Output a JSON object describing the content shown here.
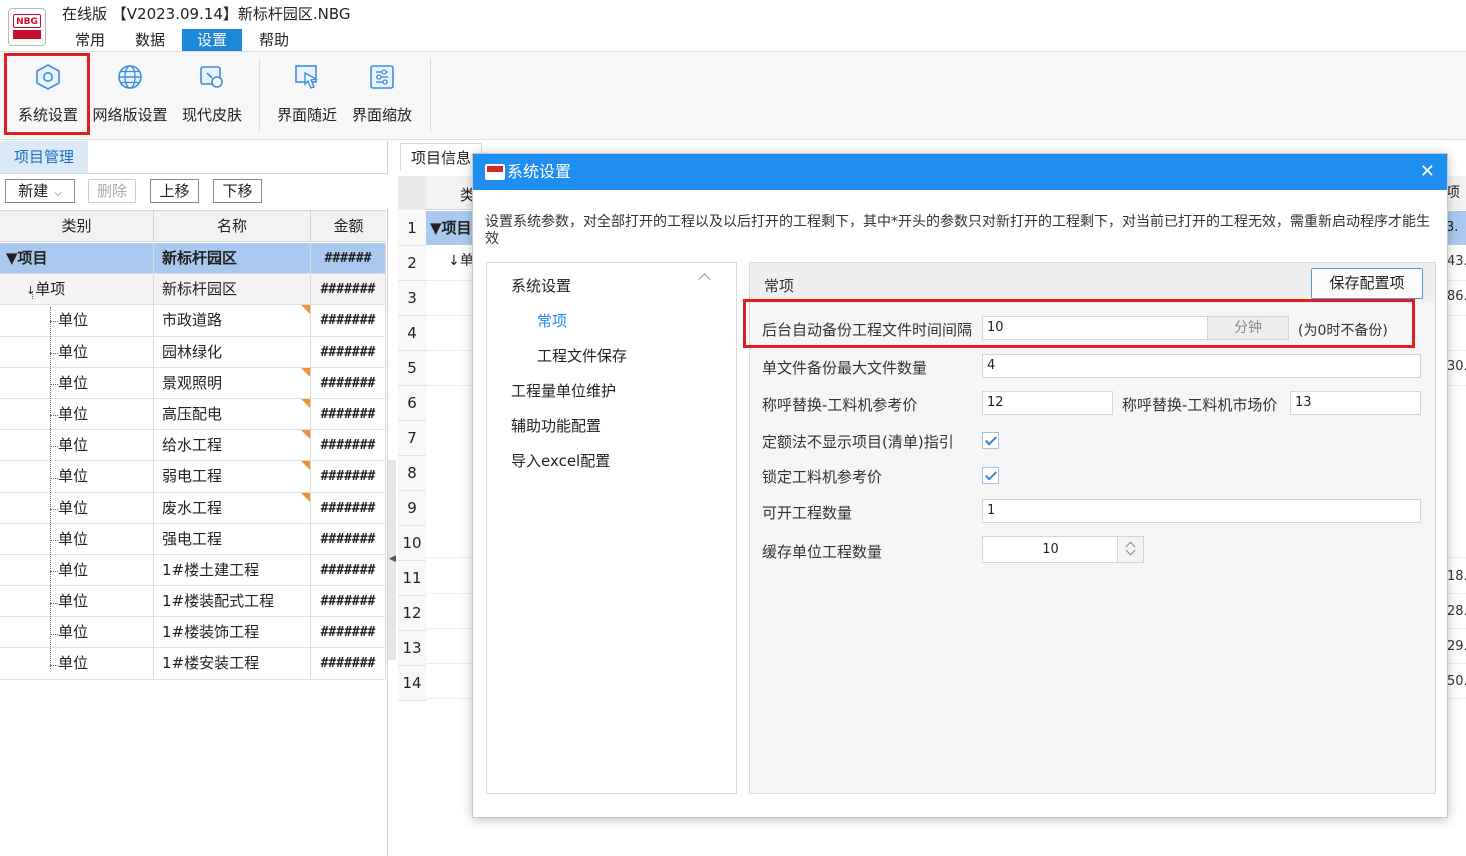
{
  "app": {
    "logo_text": "NBG",
    "title": "在线版 【V2023.09.14】新标杆园区.NBG"
  },
  "menu": [
    "常用",
    "数据",
    "设置",
    "帮助"
  ],
  "ribbon": {
    "buttons": [
      {
        "label": "系统设置",
        "icon": "gear-hexagon-icon"
      },
      {
        "label": "网络版设置",
        "icon": "globe-icon"
      },
      {
        "label": "现代皮肤",
        "icon": "skin-icon"
      },
      {
        "label": "界面随近",
        "icon": "cursor-window-icon"
      },
      {
        "label": "界面缩放",
        "icon": "sliders-icon"
      }
    ]
  },
  "left_panel": {
    "tab": "项目管理",
    "toolbar": {
      "new": "新建",
      "delete": "删除",
      "up": "上移",
      "down": "下移"
    },
    "columns": [
      "类别",
      "名称",
      "金额"
    ],
    "rows": [
      {
        "type": "项目",
        "name": "新标杆园区",
        "amount": "######",
        "flag": false
      },
      {
        "type": "单项",
        "name": "新标杆园区",
        "amount": "#######",
        "flag": false
      },
      {
        "type": "单位",
        "name": "市政道路",
        "amount": "#######",
        "flag": true
      },
      {
        "type": "单位",
        "name": "园林绿化",
        "amount": "#######",
        "flag": false
      },
      {
        "type": "单位",
        "name": "景观照明",
        "amount": "#######",
        "flag": true
      },
      {
        "type": "单位",
        "name": "高压配电",
        "amount": "#######",
        "flag": true
      },
      {
        "type": "单位",
        "name": "给水工程",
        "amount": "#######",
        "flag": true
      },
      {
        "type": "单位",
        "name": "弱电工程",
        "amount": "#######",
        "flag": true
      },
      {
        "type": "单位",
        "name": "废水工程",
        "amount": "#######",
        "flag": true
      },
      {
        "type": "单位",
        "name": "强电工程",
        "amount": "#######",
        "flag": false
      },
      {
        "type": "单位",
        "name": "1#楼土建工程",
        "amount": "#######",
        "flag": false
      },
      {
        "type": "单位",
        "name": "1#楼装配式工程",
        "amount": "#######",
        "flag": false
      },
      {
        "type": "单位",
        "name": "1#楼装饰工程",
        "amount": "#######",
        "flag": false
      },
      {
        "type": "单位",
        "name": "1#楼安装工程",
        "amount": "#######",
        "flag": false
      }
    ]
  },
  "right_bg": {
    "tab": "项目信息",
    "col_head": "类",
    "row1_label": "项目",
    "row2_label": "单",
    "row_numbers": [
      "1",
      "2",
      "3",
      "4",
      "5",
      "6",
      "7",
      "8",
      "9",
      "10",
      "11",
      "12",
      "13",
      "14"
    ],
    "right_head": "项目",
    "cut_values": [
      "3.",
      "43.",
      "86.",
      "30.",
      "18.",
      "28.",
      "29.",
      "50."
    ]
  },
  "dialog": {
    "title": "系统设置",
    "close": "✕",
    "description": "设置系统参数，对全部打开的工程以及以后打开的工程剩下，其中*开头的参数只对新打开的工程剩下，对当前已打开的工程无效，需重新启动程序才能生效",
    "nav": {
      "group": "系统设置",
      "items": [
        "常项",
        "工程文件保存"
      ],
      "others": [
        "工程量单位维护",
        "辅助功能配置",
        "导入excel配置"
      ]
    },
    "section_title": "常项",
    "save_button": "保存配置项",
    "fields": {
      "backup_interval_label": "后台自动备份工程文件时间间隔",
      "backup_interval_value": "10",
      "backup_interval_unit": "分钟",
      "backup_interval_note": "(为0时不备份)",
      "max_backup_label": "单文件备份最大文件数量",
      "max_backup_value": "4",
      "ref_price_label": "称呼替换-工料机参考价",
      "ref_price_value": "12",
      "market_price_label": "称呼替换-工料机市场价",
      "market_price_value": "13",
      "quota_hide_label": "定额法不显示项目(清单)指引",
      "lock_price_label": "锁定工料机参考价",
      "open_count_label": "可开工程数量",
      "open_count_value": "1",
      "cache_count_label": "缓存单位工程数量",
      "cache_count_value": "10"
    }
  }
}
